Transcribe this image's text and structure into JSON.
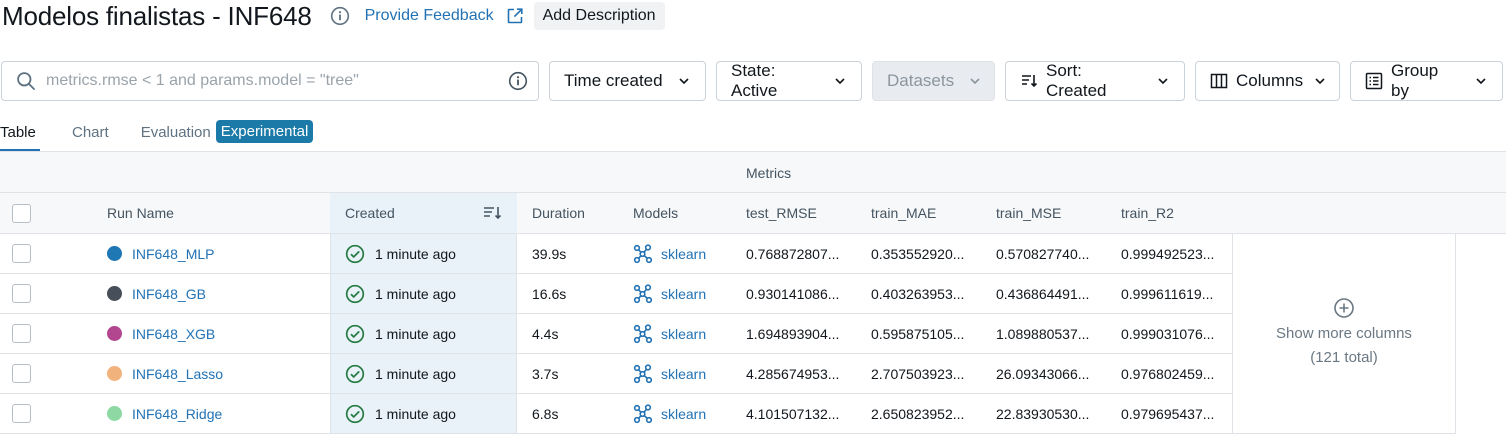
{
  "header": {
    "title": "Modelos finalistas - INF648",
    "feedback_label": "Provide Feedback",
    "add_description_label": "Add Description"
  },
  "toolbar": {
    "search_placeholder": "metrics.rmse < 1 and params.model = \"tree\"",
    "time_created_label": "Time created",
    "state_label": "State: Active",
    "datasets_label": "Datasets",
    "sort_label": "Sort: Created",
    "columns_label": "Columns",
    "group_by_label": "Group by"
  },
  "tabs": {
    "table": "Table",
    "chart": "Chart",
    "evaluation": "Evaluation",
    "experimental_badge": "Experimental"
  },
  "table": {
    "group_header": "Metrics",
    "columns": {
      "run_name": "Run Name",
      "created": "Created",
      "duration": "Duration",
      "models": "Models",
      "test_rmse": "test_RMSE",
      "train_mae": "train_MAE",
      "train_mse": "train_MSE",
      "train_r2": "train_R2"
    },
    "rows": [
      {
        "run_name": "INF648_MLP",
        "color": "#1f77b4",
        "created": "1 minute ago",
        "duration": "39.9s",
        "model": "sklearn",
        "test_rmse": "0.768872807...",
        "train_mae": "0.353552920...",
        "train_mse": "0.570827740...",
        "train_r2": "0.999492523..."
      },
      {
        "run_name": "INF648_GB",
        "color": "#474f5a",
        "created": "1 minute ago",
        "duration": "16.6s",
        "model": "sklearn",
        "test_rmse": "0.930141086...",
        "train_mae": "0.403263953...",
        "train_mse": "0.436864491...",
        "train_r2": "0.999611619..."
      },
      {
        "run_name": "INF648_XGB",
        "color": "#b2478f",
        "created": "1 minute ago",
        "duration": "4.4s",
        "model": "sklearn",
        "test_rmse": "1.694893904...",
        "train_mae": "0.595875105...",
        "train_mse": "1.089880537...",
        "train_r2": "0.999031076..."
      },
      {
        "run_name": "INF648_Lasso",
        "color": "#f2b27c",
        "created": "1 minute ago",
        "duration": "3.7s",
        "model": "sklearn",
        "test_rmse": "4.285674953...",
        "train_mae": "2.707503923...",
        "train_mse": "26.09343066...",
        "train_r2": "0.976802459..."
      },
      {
        "run_name": "INF648_Ridge",
        "color": "#8ed8a4",
        "created": "1 minute ago",
        "duration": "6.8s",
        "model": "sklearn",
        "test_rmse": "4.101507132...",
        "train_mae": "2.650823952...",
        "train_mse": "22.83930530...",
        "train_r2": "0.979695437..."
      }
    ],
    "show_more_label": "Show more columns",
    "show_more_count": "(121 total)"
  },
  "colors": {
    "accent": "#2272b4",
    "success": "#277c43",
    "badge": "#1b7aa8"
  }
}
